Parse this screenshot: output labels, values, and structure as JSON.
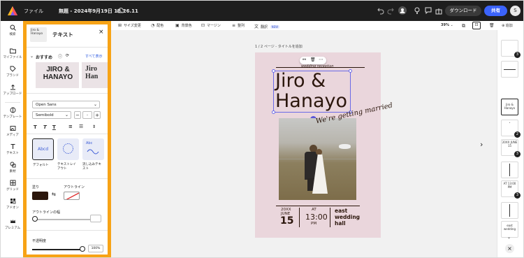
{
  "app": {
    "menu_file": "ファイル",
    "doc_title": "無題 - 2024年9月19日 18.26.11",
    "download_label": "ダウンロード",
    "share_label": "共有",
    "avatar_letter": "S",
    "accent": "#3b63fb",
    "panel_highlight": "#f7a316"
  },
  "rail": {
    "items": [
      {
        "label": "検索",
        "icon": "search-icon"
      },
      {
        "label": "マイファイル",
        "icon": "folder-icon"
      },
      {
        "label": "ブランド",
        "icon": "brand-icon"
      },
      {
        "label": "アップロード",
        "icon": "upload-icon"
      },
      {
        "label": "テンプレート",
        "icon": "template-icon"
      },
      {
        "label": "メディア",
        "icon": "media-icon"
      },
      {
        "label": "テキスト",
        "icon": "text-icon"
      },
      {
        "label": "素材",
        "icon": "elements-icon"
      },
      {
        "label": "グリッド",
        "icon": "grid-icon"
      },
      {
        "label": "アドオン",
        "icon": "addon-icon"
      },
      {
        "label": "プレミアム",
        "icon": "crown-icon"
      }
    ]
  },
  "panel": {
    "thumb_text": "Jiro & Hanayo",
    "title": "テキスト",
    "recommended": "おすすめ",
    "see_all": "すべて表示",
    "card1_text": "JIRO & HANAYO",
    "card2_text": "Jiro Han",
    "font_family": "Open Sans",
    "font_weight": "Semibold",
    "font_size": "-",
    "styles": [
      {
        "label": "デフォルト",
        "preview": "Abcd"
      },
      {
        "label": "テキストレイアウト"
      },
      {
        "label": "流し込みテキスト",
        "preview": "Abc"
      }
    ],
    "fill_label": "塗り",
    "fill_color": "#2b160c",
    "outline_label": "アウトライン",
    "outline_width_label": "アウトラインの幅",
    "opacity_label": "不透明度",
    "opacity_value": "100%"
  },
  "toolbar": {
    "resize": "サイズ変更",
    "color": "配色",
    "background": "背景色",
    "margin": "マージン",
    "arrange": "整列",
    "translate": "翻訳",
    "new_badge": "NEW",
    "zoom": "39%",
    "add": "追加"
  },
  "page": {
    "page_label": "1 / 2 ページ - タイトルを追加",
    "bg_color": "#ead6dc",
    "subtitle": "wedding reception",
    "name_line1": "Jiro &",
    "name_line2": "Hanayo",
    "script_text": "We're getting married",
    "year": "20XX",
    "month": "JUNE",
    "day": "15",
    "at": "AT",
    "time": "13:00",
    "pm": "PM",
    "venue": "east wedding hall"
  },
  "thumbs": [
    {
      "badge": "3"
    },
    {},
    {
      "text": "Jiro & Hanayo",
      "active": true
    },
    {
      "badge": "2"
    },
    {
      "text": "20XX JUNE 15",
      "badge": "3"
    },
    {},
    {
      "text": "AT 13:00 PM",
      "badge": "3"
    },
    {},
    {
      "text": "east wedding"
    }
  ]
}
